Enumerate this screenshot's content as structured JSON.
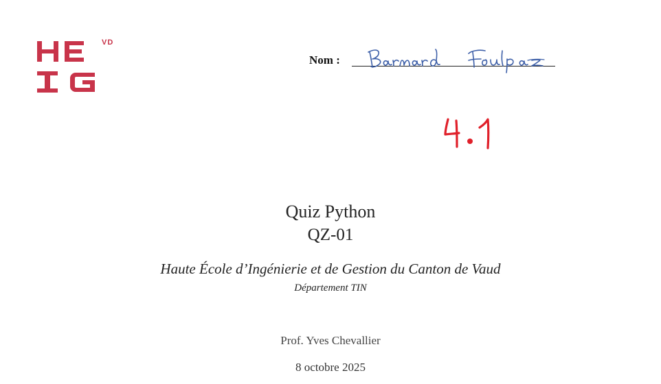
{
  "logo": {
    "line1": "HE",
    "superscript": "VD",
    "line2": "IG",
    "color": "#c8344a"
  },
  "name_field": {
    "label": "Nom :",
    "handwritten_value": "Barnard Foulpaz",
    "ink_color": "#3d5fa8"
  },
  "grade": {
    "value": "4.1",
    "ink_color": "#e0202a"
  },
  "document": {
    "title": "Quiz Python",
    "code": "QZ-01",
    "institution": "Haute École d’Ingénierie et de Gestion du Canton de Vaud",
    "department": "Département TIN",
    "author": "Prof. Yves Chevallier",
    "date": "8 octobre 2025"
  }
}
